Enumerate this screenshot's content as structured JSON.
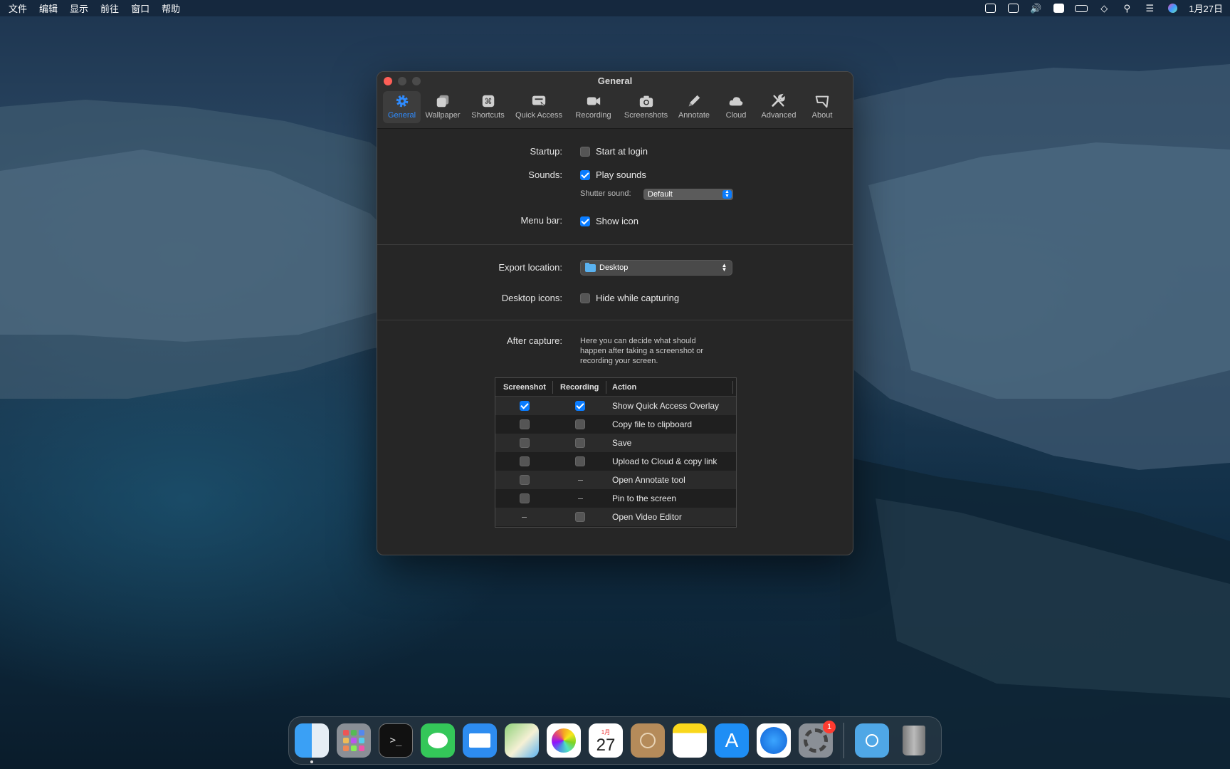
{
  "menubar": {
    "items": [
      "文件",
      "编辑",
      "显示",
      "前往",
      "窗口",
      "帮助"
    ],
    "date": "1月27日"
  },
  "window": {
    "title": "General",
    "tabs": [
      {
        "label": "General",
        "icon": "gear-icon",
        "active": true
      },
      {
        "label": "Wallpaper",
        "icon": "wallpaper-icon",
        "active": false
      },
      {
        "label": "Shortcuts",
        "icon": "command-icon",
        "active": false
      },
      {
        "label": "Quick Access",
        "icon": "quick-access-icon",
        "active": false
      },
      {
        "label": "Recording",
        "icon": "video-camera-icon",
        "active": false
      },
      {
        "label": "Screenshots",
        "icon": "camera-icon",
        "active": false
      },
      {
        "label": "Annotate",
        "icon": "pencil-icon",
        "active": false
      },
      {
        "label": "Cloud",
        "icon": "cloud-icon",
        "active": false
      },
      {
        "label": "Advanced",
        "icon": "wrench-icon",
        "active": false
      },
      {
        "label": "About",
        "icon": "about-icon",
        "active": false
      }
    ]
  },
  "general": {
    "startup_label": "Startup:",
    "start_at_login": "Start at login",
    "sounds_label": "Sounds:",
    "play_sounds": "Play sounds",
    "shutter_label": "Shutter sound:",
    "shutter_value": "Default",
    "menubar_label": "Menu bar:",
    "show_icon": "Show icon",
    "export_label": "Export location:",
    "export_value": "Desktop",
    "desktop_icons_label": "Desktop icons:",
    "hide_while_capturing": "Hide while capturing",
    "after_capture_label": "After capture:",
    "after_capture_desc": "Here you can decide what should happen after taking a screenshot or recording your screen."
  },
  "capture_table": {
    "headers": {
      "screenshot": "Screenshot",
      "recording": "Recording",
      "action": "Action"
    },
    "rows": [
      {
        "action": "Show Quick Access Overlay",
        "screenshot": "on",
        "recording": "on"
      },
      {
        "action": "Copy file to clipboard",
        "screenshot": "off",
        "recording": "off"
      },
      {
        "action": "Save",
        "screenshot": "off",
        "recording": "off"
      },
      {
        "action": "Upload to Cloud & copy link",
        "screenshot": "off",
        "recording": "off"
      },
      {
        "action": "Open Annotate tool",
        "screenshot": "off",
        "recording": "none"
      },
      {
        "action": "Pin to the screen",
        "screenshot": "off",
        "recording": "none"
      },
      {
        "action": "Open Video Editor",
        "screenshot": "none",
        "recording": "off"
      }
    ]
  },
  "dock": {
    "calendar_month": "1月",
    "calendar_day": "27",
    "settings_badge": "1"
  },
  "colors": {
    "accent": "#0a7cff",
    "window_bg": "#262626"
  }
}
